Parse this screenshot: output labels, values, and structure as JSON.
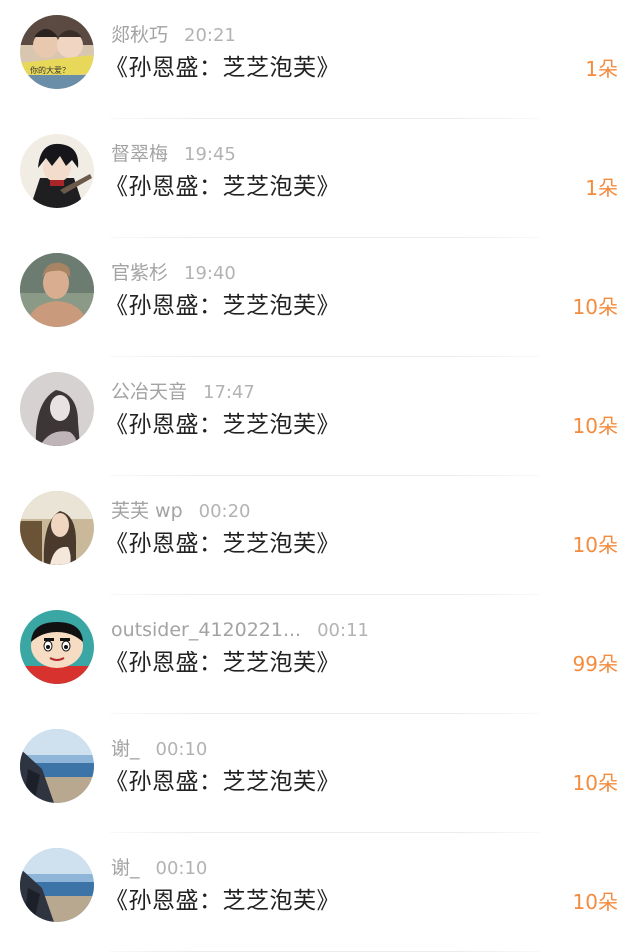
{
  "rows": [
    {
      "name": "郯秋巧",
      "time": "20:21",
      "message": "《孙恩盛：芝芝泡芙》",
      "gift": "1朵",
      "avatar": "avatar-couple-photo"
    },
    {
      "name": "督翠梅",
      "time": "19:45",
      "message": "《孙恩盛：芝芝泡芙》",
      "gift": "1朵",
      "avatar": "avatar-anime-character"
    },
    {
      "name": "官紫杉",
      "time": "19:40",
      "message": "《孙恩盛：芝芝泡芙》",
      "gift": "10朵",
      "avatar": "avatar-man-photo"
    },
    {
      "name": "公冶天音",
      "time": "17:47",
      "message": "《孙恩盛：芝芝泡芙》",
      "gift": "10朵",
      "avatar": "avatar-girl-bw-photo"
    },
    {
      "name": "芙芙 wp",
      "time": "00:20",
      "message": "《孙恩盛：芝芝泡芙》",
      "gift": "10朵",
      "avatar": "avatar-woman-car-photo"
    },
    {
      "name": "outsider_4120221...",
      "time": "00:11",
      "message": "《孙恩盛：芝芝泡芙》",
      "gift": "99朵",
      "avatar": "avatar-cartoon-boy"
    },
    {
      "name": "谢_",
      "time": "00:10",
      "message": "《孙恩盛：芝芝泡芙》",
      "gift": "10朵",
      "avatar": "avatar-beach-photo"
    },
    {
      "name": "谢_",
      "time": "00:10",
      "message": "《孙恩盛：芝芝泡芙》",
      "gift": "10朵",
      "avatar": "avatar-beach-photo"
    }
  ],
  "colors": {
    "gift": "#f48b3d",
    "name": "#a3a3a3",
    "time": "#b3b3b3",
    "message": "#222222"
  }
}
